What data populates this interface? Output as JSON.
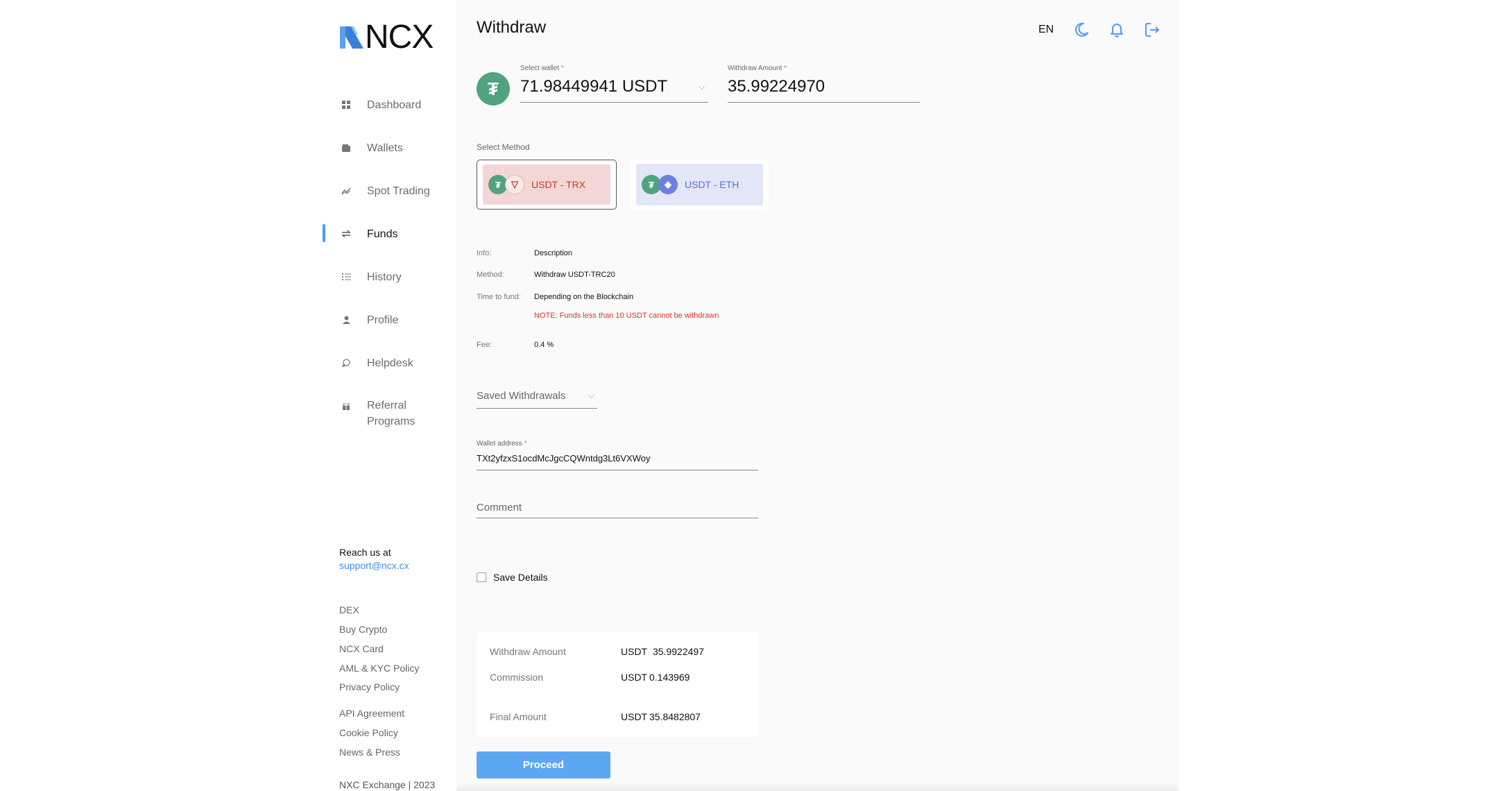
{
  "brand": {
    "logo_text": "NCX"
  },
  "sidebar": {
    "items": [
      {
        "label": "Dashboard",
        "icon": "dashboard-icon"
      },
      {
        "label": "Wallets",
        "icon": "wallet-icon"
      },
      {
        "label": "Spot Trading",
        "icon": "trading-icon"
      },
      {
        "label": "Funds",
        "icon": "transfer-icon",
        "active": true
      },
      {
        "label": "History",
        "icon": "list-icon"
      },
      {
        "label": "Profile",
        "icon": "user-icon"
      },
      {
        "label": "Helpdesk",
        "icon": "chat-icon"
      },
      {
        "label": "Referral Programs",
        "icon": "referral-icon"
      }
    ],
    "reach_label": "Reach us at",
    "reach_email": "support@ncx.cx",
    "footer_links": [
      "DEX",
      "Buy Crypto",
      "NCX Card",
      "AML & KYC Policy",
      "Privacy Policy",
      "API Agreement",
      "Cookie Policy",
      "News & Press"
    ],
    "copyright": "NXC Exchange | 2023"
  },
  "header": {
    "title": "Withdraw",
    "language": "EN"
  },
  "wallet": {
    "label": "Select wallet",
    "value": "71.98449941 USDT",
    "amount_label": "Withdraw Amount",
    "amount_value": "35.99224970",
    "required_mark": "*"
  },
  "methods": {
    "label": "Select Method",
    "options": [
      {
        "label": "USDT - TRX",
        "selected": true,
        "text_color": "#c0392b"
      },
      {
        "label": "USDT - ETH",
        "selected": false,
        "text_color": "#5b6fd6"
      }
    ]
  },
  "info": {
    "info_key": "Info:",
    "info_val": "Description",
    "method_key": "Method:",
    "method_val": "Withdraw USDT-TRC20",
    "time_key": "Time to fund:",
    "time_val": "Depending on the Blockchain",
    "note": "NOTE: Funds less than 10 USDT cannot be withdrawn",
    "fee_key": "Fee:",
    "fee_val": "0.4 %"
  },
  "form": {
    "saved_withdrawals": "Saved Withdrawals",
    "address_label": "Wallet address",
    "address_value": "TXt2yfzxS1ocdMcJgcCQWntdg3Lt6VXWoy",
    "comment_placeholder": "Comment",
    "save_details": "Save Details",
    "save_details_checked": false
  },
  "summary": {
    "rows": [
      {
        "label": "Withdraw Amount",
        "currency": "USDT",
        "value": "35.9922497"
      },
      {
        "label": "Commission",
        "currency": "USDT",
        "value": "0.143969"
      },
      {
        "label": "Final Amount",
        "currency": "USDT",
        "value": "35.8482807"
      }
    ]
  },
  "actions": {
    "proceed": "Proceed"
  },
  "colors": {
    "accent": "#4f9cf0",
    "tether": "#50a37e",
    "error": "#e0322b",
    "trx_bg": "#f3d6d6",
    "eth_bg": "#e2e6f7"
  }
}
